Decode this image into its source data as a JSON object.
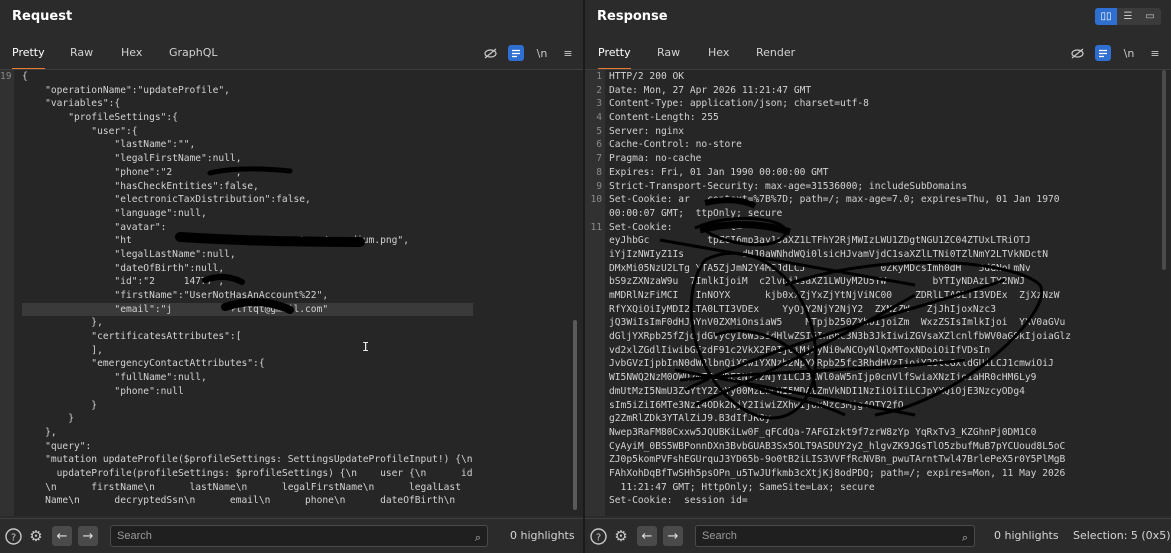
{
  "request": {
    "title": "Request",
    "tabs": [
      "Pretty",
      "Raw",
      "Hex",
      "GraphQL"
    ],
    "active_tab": "Pretty",
    "line_numbers": [
      "19",
      "",
      "",
      "",
      "",
      "",
      "",
      "",
      "",
      "",
      "",
      "",
      "",
      "",
      "",
      "",
      "",
      "",
      "",
      "",
      "",
      "",
      "",
      "",
      "",
      "",
      "",
      "",
      "",
      "",
      "",
      ""
    ],
    "code_lines": [
      "{",
      "    \"operationName\":\"updateProfile\",",
      "    \"variables\":{",
      "        \"profileSettings\":{",
      "            \"user\":{",
      "                \"lastName\":\"\",",
      "                \"legalFirstName\":null,",
      "                \"phone\":\"2          \",",
      "                \"hasCheckEntities\":false,",
      "                \"electronicTaxDistribution\":false,",
      "                \"language\":null,",
      "                \"avatar\":",
      "                \"ht                          avatars/u_medium.png\",",
      "                \"legalLastName\":null,",
      "                \"dateOfBirth\":null,",
      "                \"id\":\"2     14777\",",
      "                \"firstName\":\"UserNotHasAnAccount%22\",",
      "                \"email\":\"j          +lftqt@gmail.com\"",
      "            },",
      "            \"certificatesAttributes\":[",
      "            ],",
      "            \"emergencyContactAttributes\":{",
      "                \"fullName\":null,",
      "                \"phone\":null",
      "            }",
      "        }",
      "    },",
      "    \"query\":",
      "    \"mutation updateProfile($profileSettings: SettingsUpdateProfileInput!) {\\n",
      "      updateProfile(profileSettings: $profileSettings) {\\n    user {\\n      id",
      "    \\n      firstName\\n      lastName\\n      legalFirstName\\n      legalLast",
      "    Name\\n      decryptedSsn\\n      email\\n      phone\\n      dateOfBirth\\n"
    ],
    "search_placeholder": "Search",
    "highlights": "0 highlights"
  },
  "response": {
    "title": "Response",
    "tabs": [
      "Pretty",
      "Raw",
      "Hex",
      "Render"
    ],
    "active_tab": "Pretty",
    "line_numbers": [
      "1",
      "2",
      "3",
      "4",
      "5",
      "6",
      "7",
      "8",
      "9",
      "10",
      "",
      "11",
      "",
      "",
      "",
      "",
      "",
      "",
      "",
      "",
      "",
      "",
      "",
      "",
      "",
      "",
      "",
      "",
      "",
      "",
      "",
      "",
      "",
      "",
      "",
      "12"
    ],
    "code_lines": [
      "HTTP/2 200 OK",
      "Date: Mon, 27 Apr 2026 11:21:47 GMT",
      "Content-Type: application/json; charset=utf-8",
      "Content-Length: 255",
      "Server: nginx",
      "Cache-Control: no-store",
      "Pragma: no-cache",
      "Expires: Fri, 01 Jan 1990 00:00:00 GMT",
      "Strict-Transport-Security: max-age=31536000; includeSubDomains",
      "Set-Cookie: ar   context=%7B%7D; path=/; max-age=7.0; expires=Thu, 01 Jan 1970",
      "00:00:07 GMT;  ttpOnly; secure",
      "Set-Cookie:          t=",
      "eyJhbGc          tpZCI6mp3ay1saXZ1LTFhY2RjMWIzLWU1ZDgtNGU1ZC04ZTUxLTRiOTJ",
      "iYjIzNWIyZ1Is          dHJ0aWNhdWQi0lsicHJvamVjdC1saXZlLTNi0TZlNmY2LTVkNDctN",
      "DMxMi05NzU2LTg YTA5ZjJmN2Y4MSJdLCJ             0ZkyMDcsImh0dH   5dGNoLmNv",
      "bS9zZXNzaW9u  7ImlkIjoiM  c2lvbilsaXZ1LWUyM2U5YW        bYTIyNDAzLTY2NWJ",
      "mMDRlNzFiMCI   InNOYX      kjb0xxZjYxZjYtNjViNC00    ZDRlLTA0LTI3VDEx  ZjXzNzW",
      "RfYXQiOiIyMDI2LTA0LTI3VDEx    YyOjY2NjY2NjY2  ZXNzZW   ZjJhIjoxNzc3",
      "jQ3WiIsImF0dHJpYnV0ZXMiOnsiaW5    MTpjb250ZXh0IjoiZm  WxzZSIsImlkIjoi  YXV0aGVu",
      "dGljYXRpb25fZjdjdGVycyI6W3sidHlwZSI6InBhc3N3b3JkIiwiZGVsaXZlcnlfbWV0aG9kIjoiaGlz",
      "vd2xlZGdlIiwibGFzdF91c2VkX2F0IjoiMjAyNi0wNCOyNlQxMToxNDoiOiIfVDsIn",
      "JvbGVzIjpbInN0dWRlbnQiXSwiYXNzb2NpYXRpb25fc3RhdHVzIjoiY29tcGxldGUiLCJ1cmwiOiJ",
      "WI5NWQ2NzM0OWQ2NTEzNDE2NjY2NjYiLCJ3ZWl0aW5nIjp0cnVlfSwiaXNzIjoiaHR0cHM6Ly9",
      "dmUtMzI5NmU3ZGYtY2ZkYy00MzEwLWI5MDAtZmVkNDI1NzIiOiIiLCJpYXQiOjE3NzcyODg4",
      "sIm5iZiI6MTe3NzI4ODk2NjY2IiwiZXhwIjoxNzc3Mjg4OTY2fQ",
      "g2ZmRlZDk3YTAlZiJ9.B3dIfJK0y",
      "Nwep3RaFM80Cxxw5JQUBKiLw0F_qFCdQa-7AFGIzkt9f7zrW8zYp YqRxTv3_KZGhnPj0DM1C0",
      "CyAyiM_0BS5WBPonnDXn3BvbGUAB3Sx5OLT9ASDUY2y2_hlgvZK9JGsTlO5zbufMuB7pYCUoud8L5oC",
      "ZJ0p5komPVFshEGUrquJ3YD65b-9o0tB2iLIS3VVFfRcNVBn_pwuTArntTwl47BrlePeX5r0Y5PlMgB",
      "FAhXohDqBfTwSHh5psOPn_u5TwJUfkmb3cXtjKj8odPDQ; path=/; expires=Mon, 11 May 2026",
      "  11:21:47 GMT; HttpOnly; SameSite=Lax; secure",
      "Set-Cookie:  session id="
    ],
    "search_placeholder": "Search",
    "highlights": "0 highlights",
    "selection": "Selection: 5 (0x5)"
  },
  "icons": {
    "hide": "eye-slash-icon",
    "wrap": "wrap-lines-icon",
    "newline": "newline-icon",
    "menu": "hamburger-menu-icon",
    "help": "help-icon",
    "settings": "gear-icon",
    "back": "arrow-left-icon",
    "forward": "arrow-right-icon",
    "search": "search-icon"
  },
  "colors": {
    "accent": "#2f6fd1",
    "active_tab_underline": "#e87a2f"
  }
}
